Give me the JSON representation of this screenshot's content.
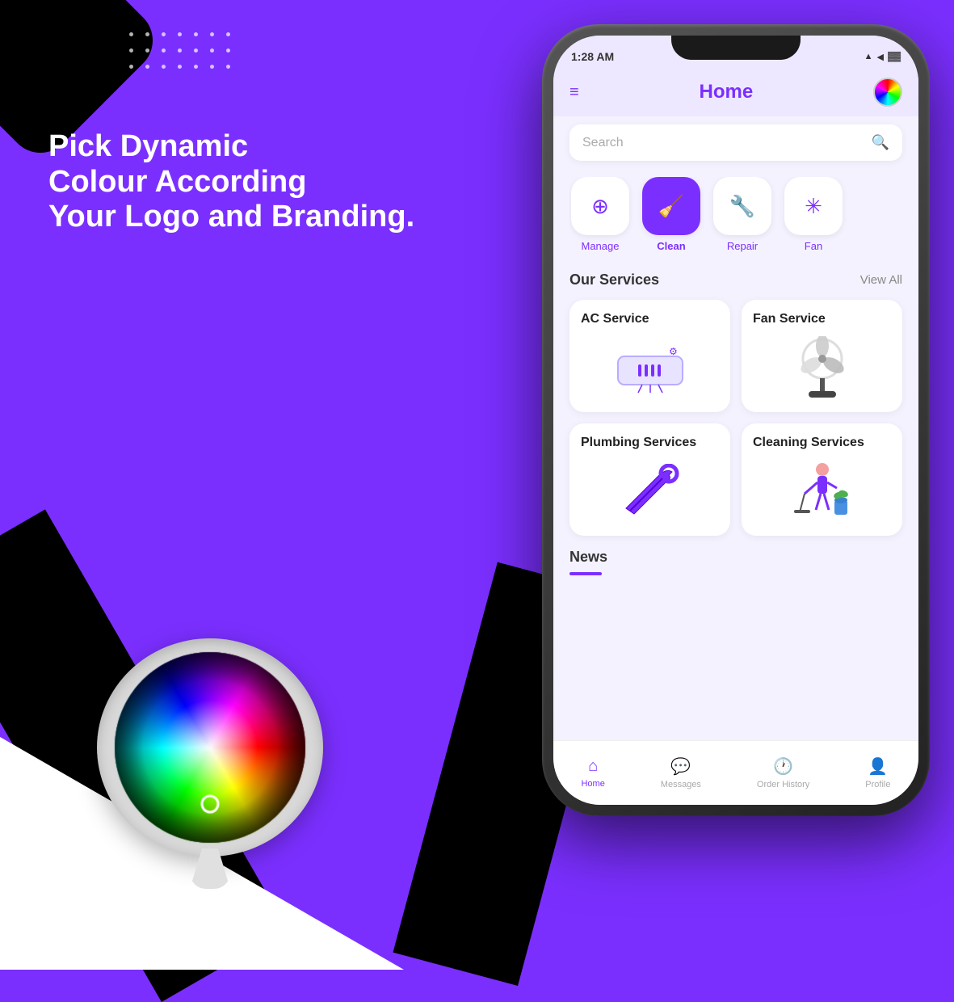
{
  "background": {
    "color": "#7B2FFF"
  },
  "left_panel": {
    "headline_line1": "Pick Dynamic",
    "headline_line2": "Colour According",
    "headline_line3": "Your Logo and Branding."
  },
  "app": {
    "status_bar": {
      "time": "1:28 AM",
      "icons": "▲ ◀ ▶"
    },
    "header": {
      "menu_icon": "≡",
      "title": "Home",
      "color_picker_label": "color-picker"
    },
    "search": {
      "placeholder": "Search"
    },
    "categories": [
      {
        "id": "manage",
        "label": "Manage",
        "icon": "👤",
        "active": false
      },
      {
        "id": "clean",
        "label": "Clean",
        "icon": "🧹",
        "active": true
      },
      {
        "id": "repair",
        "label": "Repair",
        "icon": "🔧",
        "active": false
      },
      {
        "id": "fan",
        "label": "Fan",
        "icon": "💨",
        "active": false
      }
    ],
    "services": {
      "section_title": "Our Services",
      "view_all": "View All",
      "items": [
        {
          "id": "ac",
          "title": "AC Service",
          "icon": "❄️"
        },
        {
          "id": "fan",
          "title": "Fan Service",
          "icon": "🌀"
        },
        {
          "id": "plumbing",
          "title": "Plumbing Services",
          "icon": "🔧"
        },
        {
          "id": "cleaning",
          "title": "Cleaning Services",
          "icon": "🧹"
        }
      ]
    },
    "news": {
      "title": "News"
    },
    "bottom_nav": [
      {
        "id": "home",
        "label": "Home",
        "icon": "⌂",
        "active": true
      },
      {
        "id": "messages",
        "label": "Messages",
        "icon": "💬",
        "active": false
      },
      {
        "id": "order_history",
        "label": "Order History",
        "icon": "🕐",
        "active": false
      },
      {
        "id": "profile",
        "label": "Profile",
        "icon": "👤",
        "active": false
      }
    ]
  }
}
